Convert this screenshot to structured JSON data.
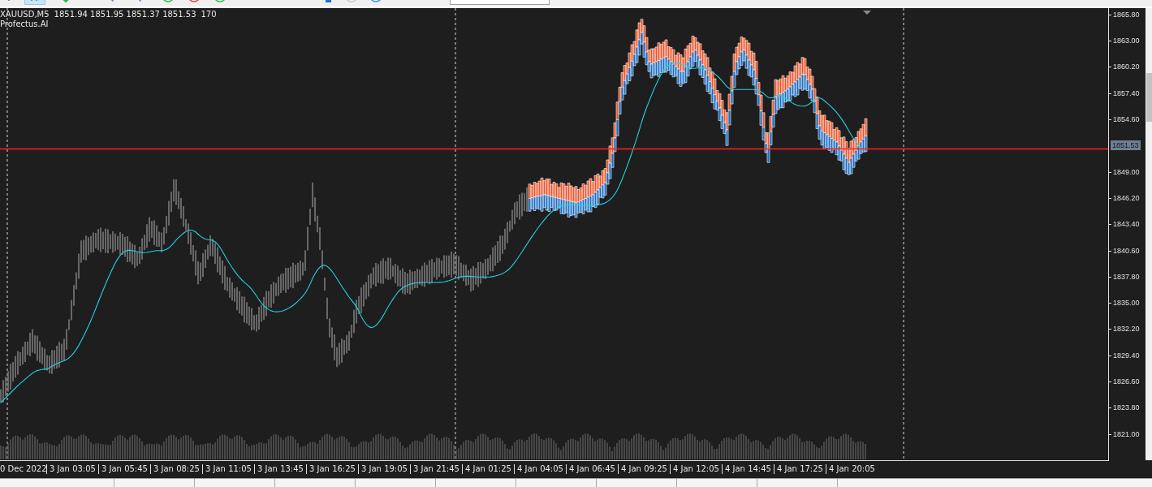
{
  "toolbar": {
    "buttons": [
      {
        "kind": "plus",
        "selected": false
      },
      {
        "kind": "bars",
        "selected": true
      },
      {
        "kind": "arrow",
        "selected": false
      },
      {
        "kind": "zoom-in",
        "selected": false
      },
      {
        "kind": "zoom-out",
        "selected": false
      },
      {
        "kind": "circle",
        "color": "#2fb84a",
        "selected": false
      },
      {
        "kind": "circle",
        "color": "#e0443a",
        "selected": false
      },
      {
        "kind": "circle",
        "color": "#2fb84a",
        "selected": false
      },
      {
        "kind": "square",
        "selected": false
      },
      {
        "kind": "circle",
        "color": "#c8c8c8",
        "selected": false
      },
      {
        "kind": "circle",
        "color": "#3a8ee6",
        "selected": false
      }
    ]
  },
  "chart": {
    "title": "XAUUSD,M5",
    "quote": "1851.94 1851.95 1851.37 1851.53",
    "volume": "170",
    "indicator": "Profectus.AI"
  },
  "price_axis": {
    "labels": [
      {
        "text": "1865.80",
        "current": false
      },
      {
        "text": "1863.00",
        "current": false
      },
      {
        "text": "1860.20",
        "current": false
      },
      {
        "text": "1857.40",
        "current": false
      },
      {
        "text": "1854.60",
        "current": false
      },
      {
        "text": "1851.53",
        "current": true
      },
      {
        "text": "1849.00",
        "current": false
      },
      {
        "text": "1846.20",
        "current": false
      },
      {
        "text": "1843.40",
        "current": false
      },
      {
        "text": "1840.60",
        "current": false
      },
      {
        "text": "1837.80",
        "current": false
      },
      {
        "text": "1835.00",
        "current": false
      },
      {
        "text": "1832.20",
        "current": false
      },
      {
        "text": "1829.40",
        "current": false
      },
      {
        "text": "1826.60",
        "current": false
      },
      {
        "text": "1823.80",
        "current": false
      },
      {
        "text": "1821.00",
        "current": false
      }
    ]
  },
  "time_axis": {
    "first": "0 Dec 2022",
    "labels": [
      "3 Jan 03:05",
      "3 Jan 05:45",
      "3 Jan 08:25",
      "3 Jan 11:05",
      "3 Jan 13:45",
      "3 Jan 16:25",
      "3 Jan 19:05",
      "3 Jan 21:45",
      "4 Jan 01:25",
      "4 Jan 04:05",
      "4 Jan 06:45",
      "4 Jan 09:25",
      "4 Jan 12:05",
      "4 Jan 14:45",
      "4 Jan 17:25",
      "4 Jan 20:05"
    ]
  }
}
